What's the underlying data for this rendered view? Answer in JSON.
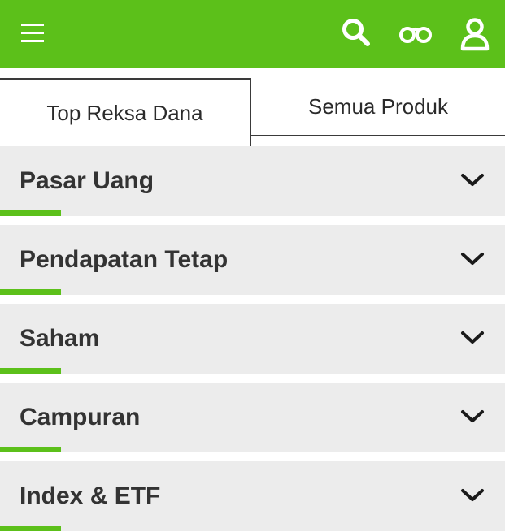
{
  "header": {
    "background_color": "#5cc01a",
    "icons": [
      "menu-icon",
      "search-icon",
      "binoculars-icon",
      "user-icon"
    ]
  },
  "tabs": [
    {
      "label": "Top Reksa Dana",
      "active": true
    },
    {
      "label": "Semua Produk",
      "active": false
    }
  ],
  "categories": [
    {
      "label": "Pasar Uang"
    },
    {
      "label": "Pendapatan Tetap"
    },
    {
      "label": "Saham"
    },
    {
      "label": "Campuran"
    },
    {
      "label": "Index & ETF"
    }
  ],
  "colors": {
    "accent": "#5cc01a",
    "item_background": "#ececec",
    "text": "#333333"
  }
}
